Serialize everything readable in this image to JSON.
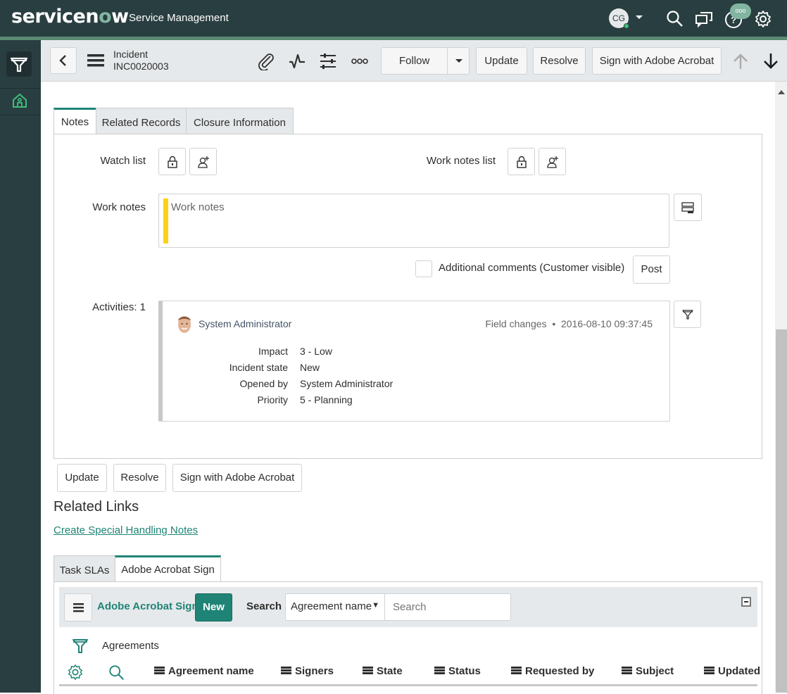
{
  "topbar": {
    "brand_prefix": "servicen",
    "brand_o": "o",
    "brand_suffix": "w",
    "app_name": "Service Management",
    "user_initials": "CG",
    "chat_badge": "ooo",
    "icons": [
      "search-icon",
      "chat-icon",
      "help-icon",
      "gear-icon"
    ]
  },
  "sidebar": {
    "items": [
      {
        "name": "filter-navigator",
        "icon": "filter-icon"
      },
      {
        "name": "home",
        "icon": "home-icon"
      }
    ]
  },
  "header": {
    "record_type": "Incident",
    "record_number": "INC0020003",
    "icons": [
      "paperclip-icon",
      "activity-icon",
      "sliders-icon",
      "more-icon"
    ],
    "buttons": {
      "follow": "Follow",
      "update": "Update",
      "resolve": "Resolve",
      "sign": "Sign with Adobe Acrobat"
    }
  },
  "tabs": [
    {
      "label": "Notes",
      "active": true
    },
    {
      "label": "Related Records",
      "active": false
    },
    {
      "label": "Closure Information",
      "active": false
    }
  ],
  "notes": {
    "watch_list_label": "Watch list",
    "work_notes_list_label": "Work notes list",
    "work_notes_label": "Work notes",
    "work_notes_placeholder": "Work notes",
    "work_notes_value": "",
    "additional_comments_label": "Additional comments (Customer visible)",
    "additional_comments_checked": false,
    "post_label": "Post",
    "activities_label": "Activities: 1",
    "work_notes_accent": "#fcd116"
  },
  "activity": {
    "user": "System Administrator",
    "type": "Field changes",
    "separator": "•",
    "timestamp": "2016-08-10 09:37:45",
    "fields": [
      {
        "key": "Impact",
        "value": "3 - Low"
      },
      {
        "key": "Incident state",
        "value": "New"
      },
      {
        "key": "Opened by",
        "value": "System Administrator"
      },
      {
        "key": "Priority",
        "value": "5 - Planning"
      }
    ]
  },
  "form_buttons": {
    "update": "Update",
    "resolve": "Resolve",
    "sign": "Sign with Adobe Acrobat"
  },
  "related_links": {
    "title": "Related Links",
    "links": [
      "Create Special Handling Notes"
    ]
  },
  "related_tabs": [
    {
      "label": "Task SLAs",
      "active": false
    },
    {
      "label": "Adobe Acrobat Sign",
      "active": true
    }
  ],
  "related_list": {
    "title": "Adobe Acrobat Sign",
    "new_label": "New",
    "search_label": "Search",
    "search_field": "Agreement name",
    "search_placeholder": "Search",
    "search_value": "",
    "breadcrumb": "Agreements",
    "columns": [
      "Agreement name",
      "Signers",
      "State",
      "Status",
      "Requested by",
      "Subject",
      "Updated"
    ]
  },
  "colors": {
    "brand_dark": "#293e40",
    "accent_green": "#1f8476",
    "brand_light_green": "#81b5a1"
  }
}
